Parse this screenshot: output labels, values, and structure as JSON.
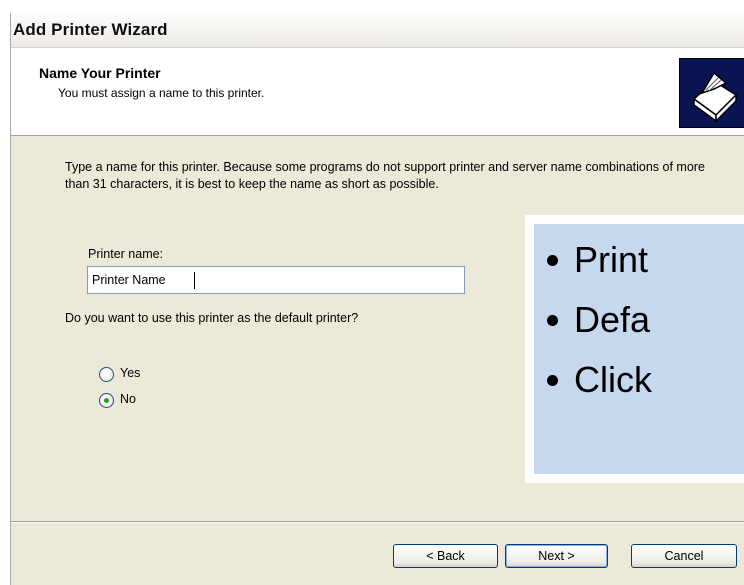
{
  "window": {
    "title": "Add Printer Wizard"
  },
  "header": {
    "title": "Name Your Printer",
    "subtitle": "You must assign a name to this printer."
  },
  "body": {
    "description": "Type a name for this printer. Because some programs do not support printer and server name combinations of more than 31 characters, it is best to keep the name as short as possible.",
    "printer_name_label": "Printer name:",
    "printer_name_value": "Printer Name",
    "default_question": "Do you want to use this printer as the default printer?",
    "options": [
      {
        "label": "Yes",
        "selected": false
      },
      {
        "label": "No",
        "selected": true
      }
    ]
  },
  "buttons": {
    "back": "< Back",
    "next": "Next >",
    "cancel": "Cancel"
  },
  "overlay": {
    "bullets": [
      "Print",
      "Defa",
      "Click"
    ]
  },
  "icons": {
    "header_icon": "printer-icon"
  }
}
